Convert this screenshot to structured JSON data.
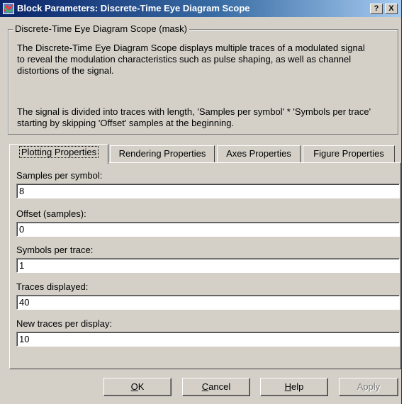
{
  "window": {
    "title": "Block Parameters: Discrete-Time Eye Diagram Scope",
    "help_button": "?",
    "close_button": "X"
  },
  "mask": {
    "group_title": "Discrete-Time Eye Diagram Scope (mask)",
    "description_lines": [
      "The Discrete-Time Eye Diagram Scope displays multiple traces of a modulated signal",
      "to reveal the modulation characteristics such as pulse shaping, as well as channel",
      "distortions of the signal."
    ],
    "note_lines": [
      "The signal is divided into traces with length, 'Samples per symbol'  * 'Symbols per trace'",
      "starting by skipping 'Offset' samples at the beginning."
    ]
  },
  "tabs": [
    {
      "label": "Plotting Properties",
      "active": true
    },
    {
      "label": "Rendering Properties",
      "active": false
    },
    {
      "label": "Axes Properties",
      "active": false
    },
    {
      "label": "Figure Properties",
      "active": false
    }
  ],
  "fields": [
    {
      "label": "Samples per symbol:",
      "value": "8"
    },
    {
      "label": "Offset (samples):",
      "value": "0"
    },
    {
      "label": "Symbols per trace:",
      "value": "1"
    },
    {
      "label": "Traces displayed:",
      "value": "40"
    },
    {
      "label": "New traces per display:",
      "value": "10"
    }
  ],
  "buttons": {
    "ok": {
      "mnemonic": "O",
      "rest": "K"
    },
    "cancel": {
      "mnemonic": "C",
      "rest": "ancel"
    },
    "help": {
      "mnemonic": "H",
      "rest": "elp"
    },
    "apply": {
      "label": "Apply",
      "enabled": false
    }
  }
}
